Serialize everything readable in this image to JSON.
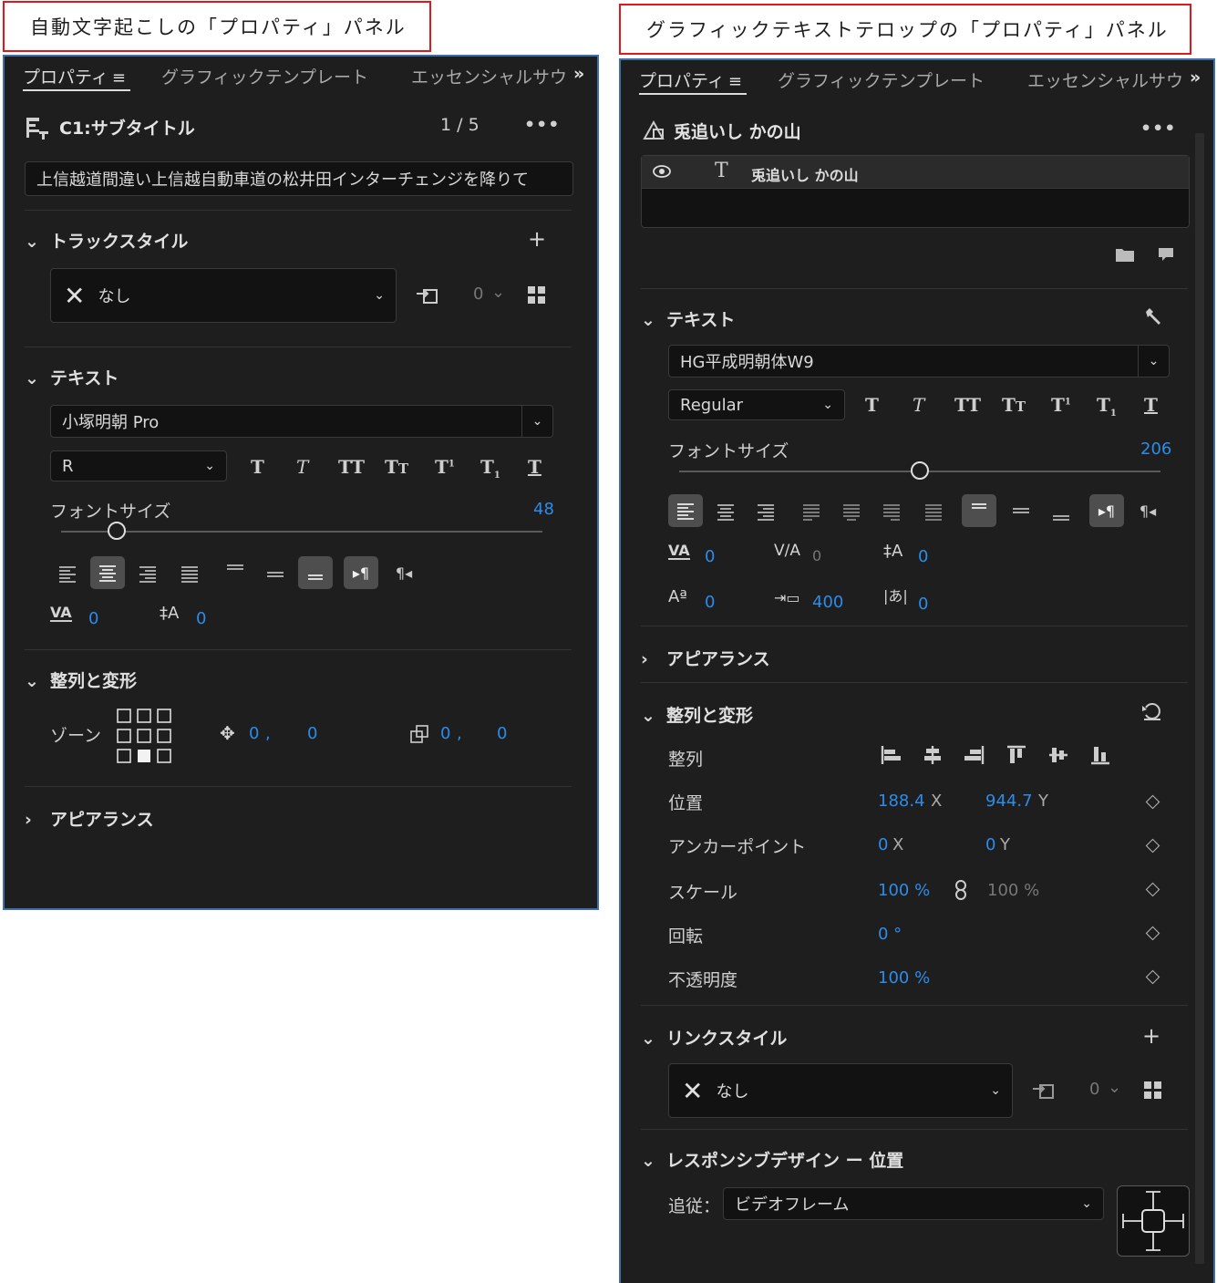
{
  "captions": {
    "left": "自動文字起こしの「プロパティ」パネル",
    "right": "グラフィックテキストテロップの「プロパティ」パネル"
  },
  "tabs": {
    "properties": "プロパティ",
    "graphic_templates": "グラフィックテンプレート",
    "essential_sound": "エッセンシャルサウ",
    "overflow": "»"
  },
  "left_panel": {
    "clip_title": "C1:サブタイトル",
    "pager": "1 / 5",
    "more": "•••",
    "caption_text": "上信越道間違い上信越自動車道の松井田インターチェンジを降りて",
    "track_style": {
      "title": "トラックスタイル",
      "style_value": "なし",
      "count": "0"
    },
    "text": {
      "title": "テキスト",
      "font": "小塚明朝 Pro",
      "weight": "R",
      "font_size_label": "フォントサイズ",
      "font_size": "48",
      "font_size_fraction": 0.1,
      "kerning": "0",
      "leading": "0"
    },
    "align": {
      "title": "整列と変形",
      "zone_label": "ゾーン",
      "pos_x": "0",
      "pos_y": "0",
      "size_x": "0",
      "size_y": "0"
    },
    "appearance": "アピアランス"
  },
  "right_panel": {
    "layer_title": "兎追いし かの山",
    "more": "•••",
    "layer_item": "兎追いし かの山",
    "text": {
      "title": "テキスト",
      "font": "HG平成明朝体W9",
      "weight": "Regular",
      "font_size_label": "フォントサイズ",
      "font_size": "206",
      "font_size_fraction": 0.5,
      "kerning": "0",
      "tracking": "0",
      "leading": "0",
      "baseline_shift": "0",
      "tab_width": "400",
      "tsume": "0"
    },
    "appearance": "アピアランス",
    "align": {
      "title": "整列と変形",
      "align_label": "整列",
      "position_label": "位置",
      "position_x": "188.4",
      "position_y": "944.7",
      "anchor_label": "アンカーポイント",
      "anchor_x": "0",
      "anchor_y": "0",
      "scale_label": "スケール",
      "scale": "100 %",
      "scale_linked": "100 %",
      "rotation_label": "回転",
      "rotation": "0 °",
      "opacity_label": "不透明度",
      "opacity": "100 %",
      "x_unit": "X",
      "y_unit": "Y"
    },
    "link_style": {
      "title": "リンクスタイル",
      "style_value": "なし",
      "count": "0"
    },
    "responsive": {
      "title": "レスポンシブデザイン ー 位置",
      "follow_label": "追従：",
      "follow_value": "ビデオフレーム"
    }
  },
  "icons": {
    "menu": "≡",
    "plus": "+",
    "close": "✕",
    "eye": "👁",
    "chevron_down": "⌄",
    "chevron_right": "›",
    "text_tool": "T",
    "wrench": "🔧",
    "link": "🔗"
  }
}
